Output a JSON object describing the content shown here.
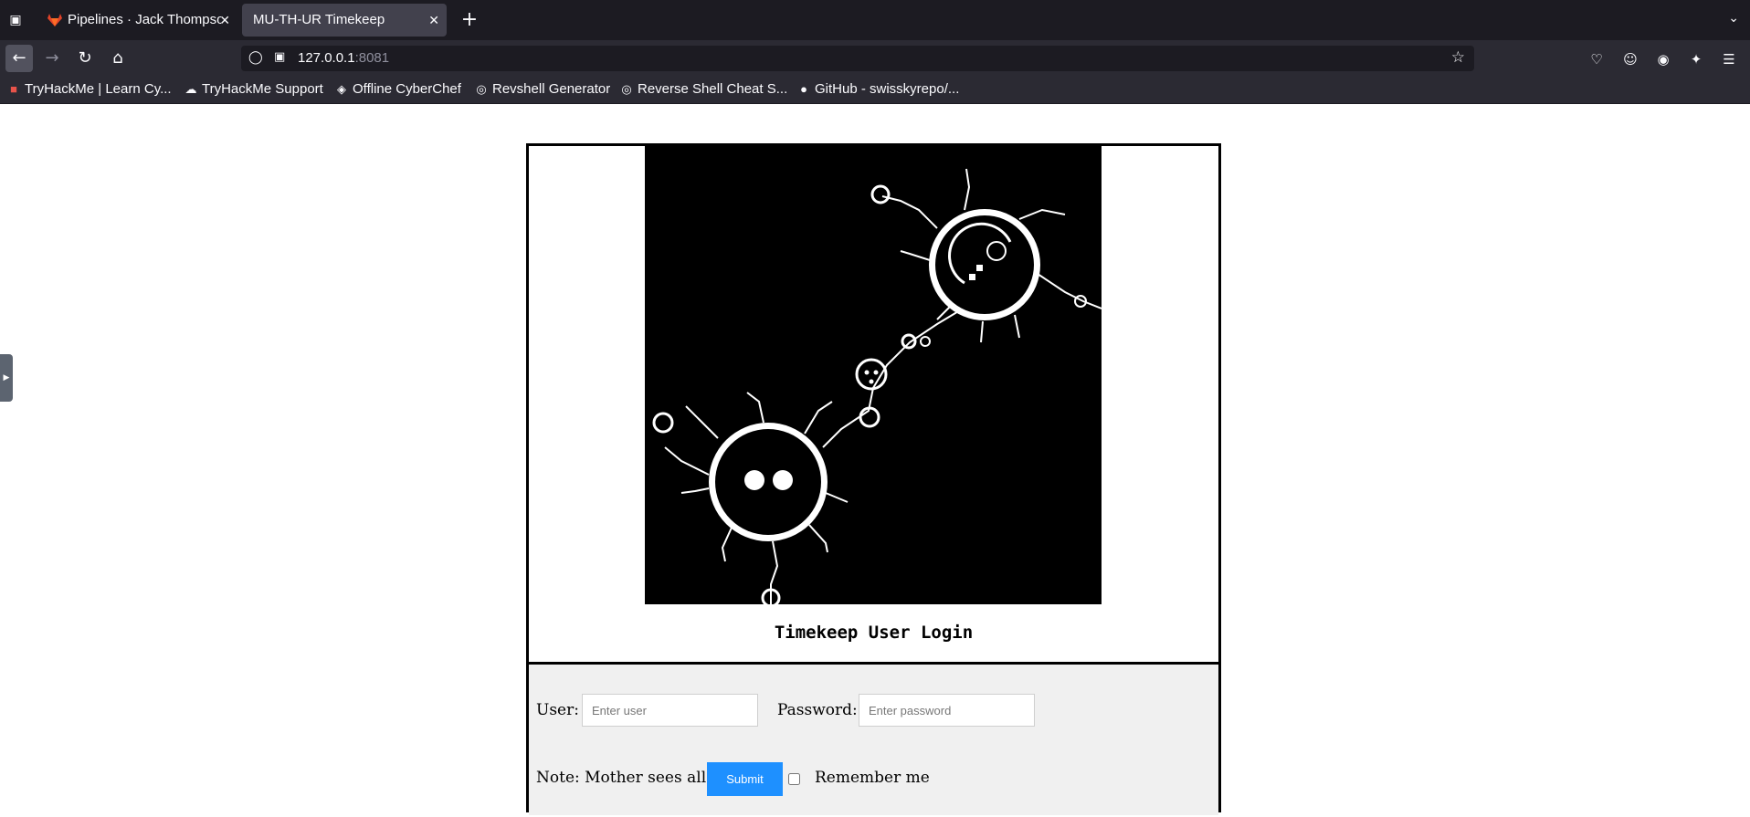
{
  "browser": {
    "tabs": [
      {
        "title": "Pipelines · Jack Thompson",
        "active": false,
        "icon": "gitlab-icon"
      },
      {
        "title": "MU-TH-UR Timekeep",
        "active": true,
        "icon": ""
      }
    ],
    "url_host": "127.0.0.1",
    "url_port": ":8081",
    "bookmarks": [
      {
        "label": "TryHackMe | Learn Cy...",
        "icon": "tryhackme-icon"
      },
      {
        "label": "TryHackMe Support",
        "icon": "cloud-icon"
      },
      {
        "label": "Offline CyberChef",
        "icon": "chef-icon"
      },
      {
        "label": "Revshell Generator",
        "icon": "globe-icon"
      },
      {
        "label": "Reverse Shell Cheat S...",
        "icon": "globe-icon"
      },
      {
        "label": "GitHub - swisskyrepo/...",
        "icon": "github-icon"
      }
    ]
  },
  "page": {
    "title": "Timekeep User Login",
    "user_label": "User:",
    "user_placeholder": "Enter user",
    "password_label": "Password:",
    "password_placeholder": "Enter password",
    "note": "Note: Mother sees all",
    "submit_label": "Submit",
    "remember_label": "Remember me",
    "colors": {
      "submit": "#1e90ff",
      "form_bg": "#f0f0f0"
    }
  }
}
